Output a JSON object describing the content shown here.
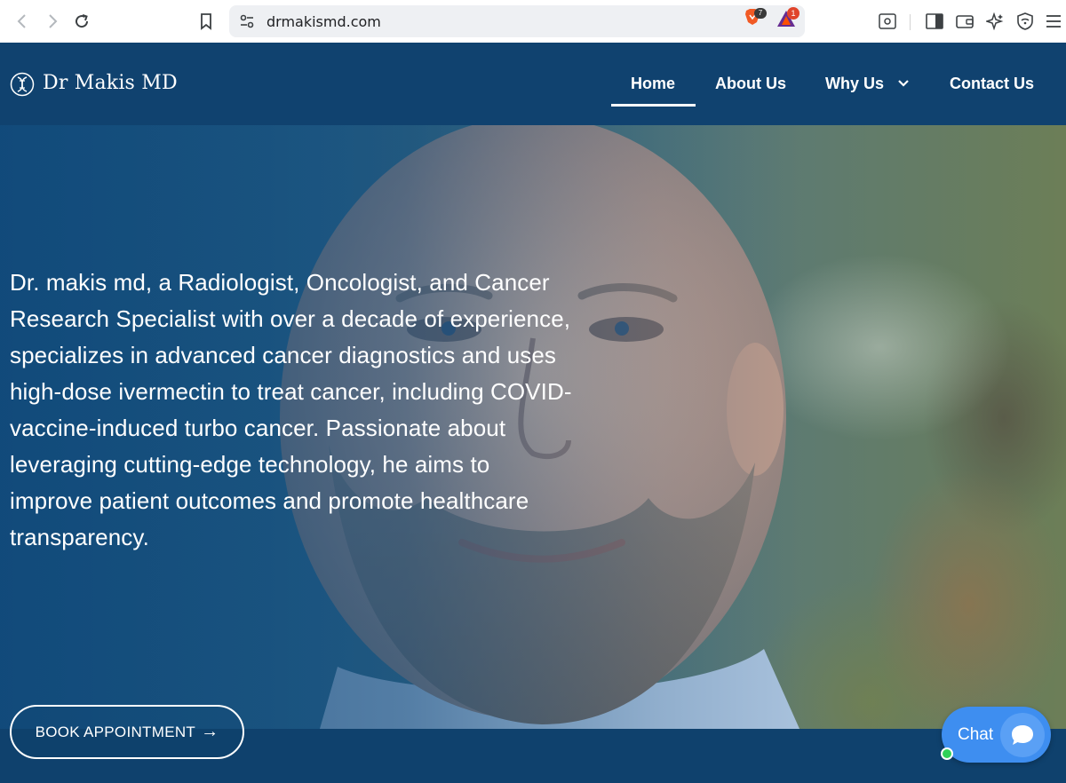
{
  "browser": {
    "url": "drmakismd.com",
    "shield_count": "7",
    "rewards_count": "1"
  },
  "site": {
    "logo_text": "Dr Makis MD",
    "nav": {
      "home": "Home",
      "about": "About Us",
      "why": "Why Us",
      "contact": "Contact Us"
    }
  },
  "hero": {
    "text": "Dr. makis md, a Radiologist, Oncologist, and Cancer Research Specialist with over a decade of experience, specializes in advanced cancer diagnostics and uses high-dose ivermectin to treat cancer, including COVID-vaccine-induced turbo cancer. Passionate about leveraging cutting-edge technology, he aims to improve patient outcomes and promote healthcare transparency.",
    "cta_label": "BOOK APPOINTMENT",
    "cta_arrow": "→"
  },
  "chat": {
    "label": "Chat"
  },
  "colors": {
    "nav_bg": "#10426f",
    "chat_blue": "#3e8ef0",
    "online_green": "#30d158"
  }
}
